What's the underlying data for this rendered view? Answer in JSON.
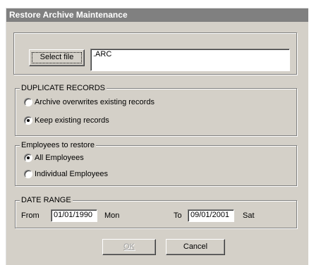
{
  "window": {
    "title": "Restore Archive Maintenance"
  },
  "file": {
    "select_label": "Select file",
    "path_value": ".ARC"
  },
  "duplicate": {
    "legend": "DUPLICATE RECORDS",
    "options": [
      {
        "label": "Archive overwrites existing records",
        "selected": false
      },
      {
        "label": "Keep existing records",
        "selected": true
      }
    ]
  },
  "employees": {
    "legend": "Employees to restore",
    "options": [
      {
        "label": "All Employees",
        "selected": true
      },
      {
        "label": "Individual Employees",
        "selected": false
      }
    ]
  },
  "date_range": {
    "legend": "DATE RANGE",
    "from_label": "From",
    "from_value": "01/01/1990",
    "from_day": "Mon",
    "to_label": "To",
    "to_value": "09/01/2001",
    "to_day": "Sat"
  },
  "buttons": {
    "ok_label": "OK",
    "cancel_label": "Cancel"
  }
}
